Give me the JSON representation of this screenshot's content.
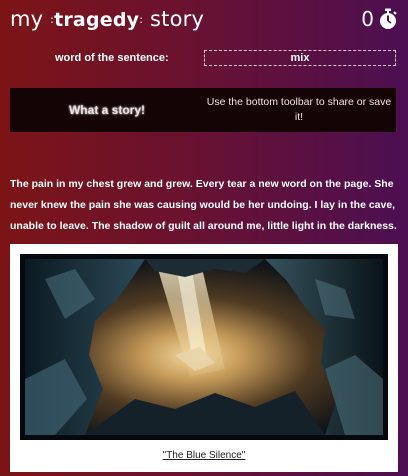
{
  "app": {
    "title_pre": "my ",
    "title_mid": "tragedy",
    "title_post": " story",
    "counter": "0",
    "counter_icon": "stopwatch-icon"
  },
  "word_of_sentence": {
    "label": "word of the sentence:",
    "value": "mix"
  },
  "banner": {
    "title": "What a story!",
    "message": "Use the bottom toolbar to share or save it!"
  },
  "story": {
    "text": "The pain in my chest grew and grew. Every tear a new word on the page. She never knew the pain she was causing would be her undoing. I lay in the cave, unable to leave. The shadow of guilt all around me, little light in the darkness."
  },
  "image": {
    "caption": "\"The Blue Silence\""
  },
  "colors": {
    "bg_left": "#7c1416",
    "bg_right": "#4c0f52",
    "banner_bg": "#140406"
  }
}
